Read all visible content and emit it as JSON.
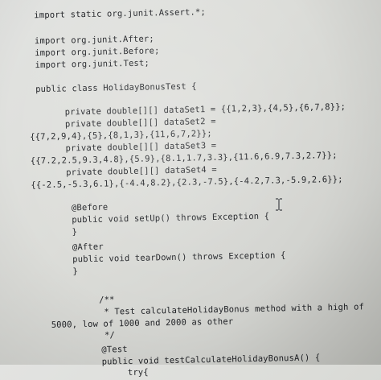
{
  "editor": {
    "lines": [
      "import static org.junit.Assert.*;",
      "import org.junit.After;",
      "import org.junit.Before;",
      "import org.junit.Test;",
      "public class HolidayBonusTest {",
      "private double[][] dataSet1 = {{1,2,3},{4,5},{6,7,8}};",
      "private double[][] dataSet2 =",
      "{{7,2,9,4},{5},{8,1,3},{11,6,7,2}};",
      "private double[][] dataSet3 =",
      "{{7.2,2.5,9.3,4.8},{5.9},{8.1,1.7,3.3},{11.6,6.9,7.3,2.7}};",
      "private double[][] dataSet4 =",
      "{{-2.5,-5.3,6.1},{-4.4,8.2},{2.3,-7.5},{-4.2,7.3,-5.9,2.6}};",
      "@Before",
      "public void setUp() throws Exception {",
      "}",
      "@After",
      "public void tearDown() throws Exception {",
      "}",
      "/**",
      "* Test calculateHolidayBonus method with a high of",
      "5000, low of 1000 and 2000 as other",
      "*/",
      "@Test",
      "public void testCalculateHolidayBonusA() {",
      "try{"
    ]
  },
  "cursor": {
    "icon": "text-cursor-icon"
  }
}
